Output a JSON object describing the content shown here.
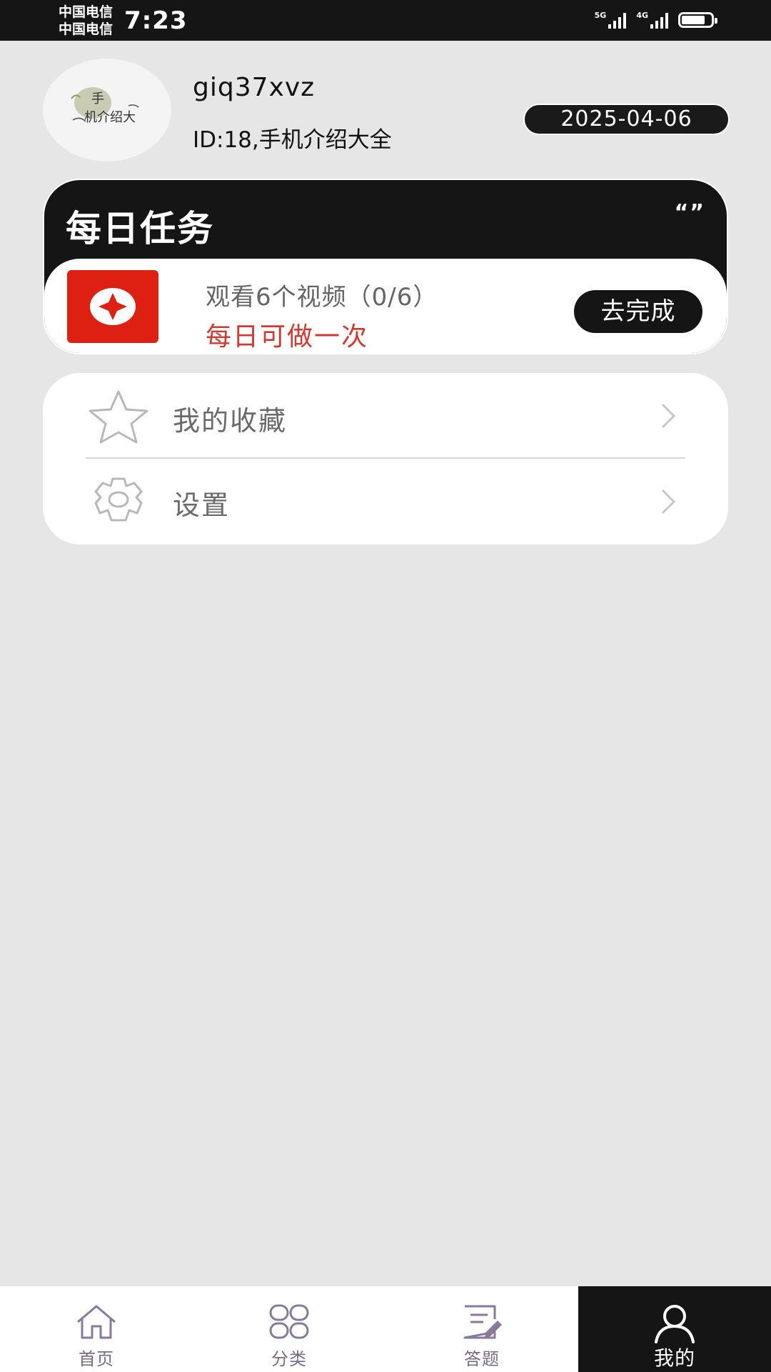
{
  "status_bar": {
    "carrier_1": "中国电信",
    "carrier_2": "中国电信",
    "time": "7:23",
    "network_1": "5G",
    "network_2": "4G",
    "battery_level": 0.8
  },
  "profile": {
    "username": "giq37xvz",
    "user_id": "ID:18,手机介绍大全",
    "date": "2025-04-06",
    "avatar_text": "手机介绍大"
  },
  "daily_task": {
    "title": "每日任务",
    "quote_mark": "“”",
    "task_name": "观看6个视频（0/6）",
    "task_frequency": "每日可做一次",
    "action_label": "去完成",
    "icon_color": "#dd2012",
    "frequency_color": "#d13a33"
  },
  "menu": {
    "items": [
      {
        "label": "我的收藏",
        "icon": "star-icon"
      },
      {
        "label": "设置",
        "icon": "gear-icon"
      }
    ]
  },
  "tabs": [
    {
      "label": "首页",
      "icon": "home-icon",
      "active": false
    },
    {
      "label": "分类",
      "icon": "category-icon",
      "active": false
    },
    {
      "label": "答题",
      "icon": "quiz-icon",
      "active": false
    },
    {
      "label": "我的",
      "icon": "profile-icon",
      "active": true
    }
  ],
  "colors": {
    "background": "#e6e6e6",
    "dark": "#151515",
    "tab_inactive": "#7a6a8a"
  }
}
